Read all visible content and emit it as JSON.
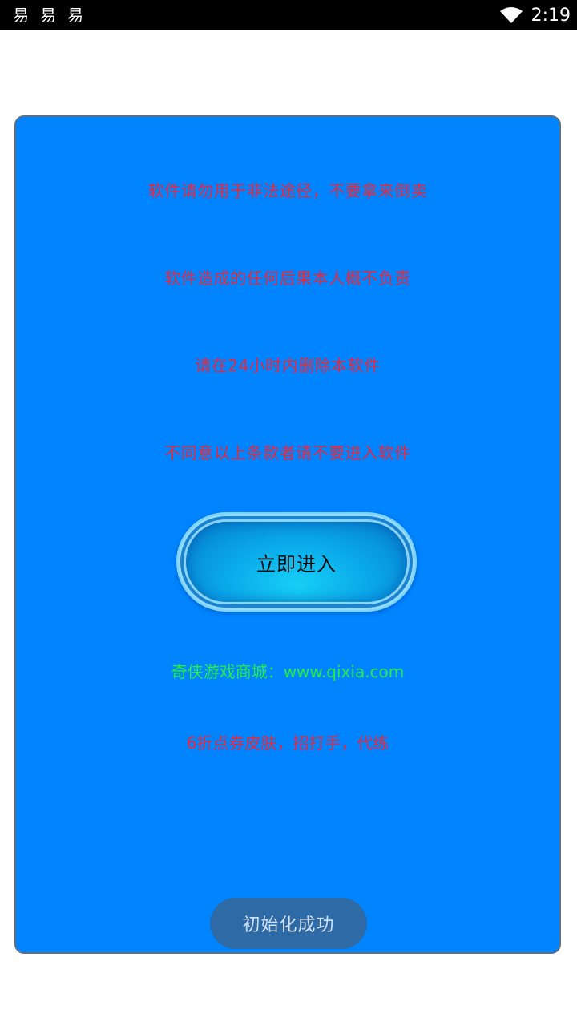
{
  "status_bar": {
    "app_icons": [
      "易",
      "易",
      "易"
    ],
    "time": "2:19"
  },
  "panel": {
    "notices": [
      "软件请勿用于非法途径，不要拿来倒卖",
      "软件造成的任何后果本人概不负责",
      "请在24小时内删除本软件",
      "不同意以上条款者请不要进入软件"
    ],
    "enter_button_label": "立即进入",
    "shop_link": "奇侠游戏商城：www.qixia.com",
    "promo": "6折点券皮肤，招打手，代练"
  },
  "toast": {
    "message": "初始化成功"
  },
  "colors": {
    "panel_background": "#0084ff",
    "notice_text": "#e8283a",
    "link_text": "#22ee44",
    "toast_background": "#2e6aa6"
  }
}
